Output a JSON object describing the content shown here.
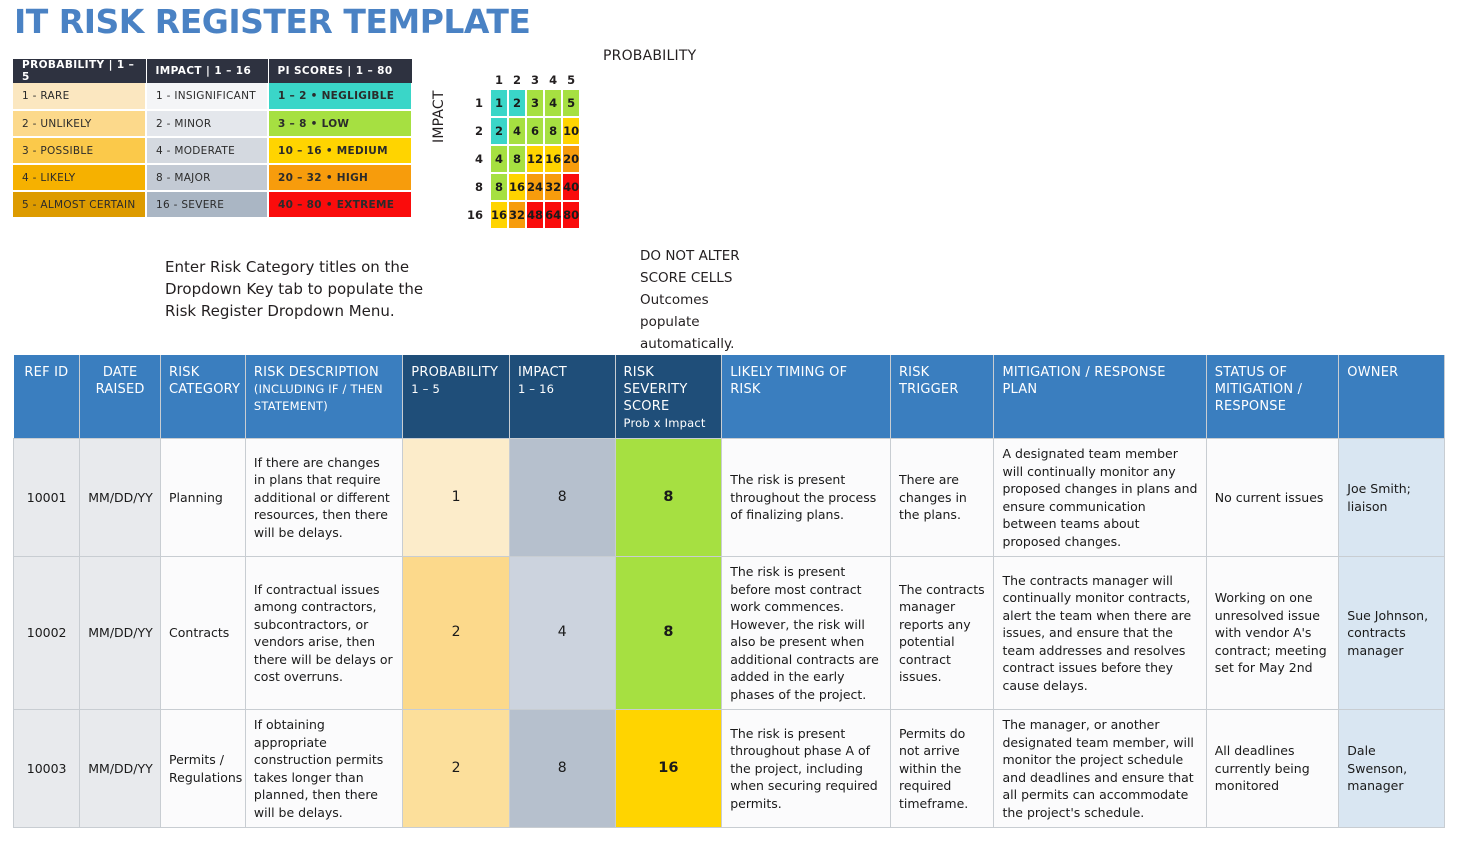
{
  "title": "IT RISK REGISTER TEMPLATE",
  "legend": {
    "headers": [
      "PROBABILITY | 1 – 5",
      "IMPACT | 1 – 16",
      "PI SCORES | 1 – 80"
    ],
    "probability": [
      {
        "label": "1 - RARE",
        "color": "#fbe7c0"
      },
      {
        "label": "2 - UNLIKELY",
        "color": "#fcd98b"
      },
      {
        "label": "3 - POSSIBLE",
        "color": "#fbc council"
      },
      {
        "label": "4 - LIKELY",
        "color": "#f6b100"
      },
      {
        "label": "5 - ALMOST CERTAIN",
        "color": "#dd9b00"
      }
    ],
    "impact": [
      {
        "label": "1 - INSIGNIFICANT",
        "color": "#f4f5f7"
      },
      {
        "label": "2 - MINOR",
        "color": "#e4e7ec"
      },
      {
        "label": "4 - MODERATE",
        "color": "#d4d9e0"
      },
      {
        "label": "8 - MAJOR",
        "color": "#c3cad4"
      },
      {
        "label": "16 - SEVERE",
        "color": "#aab6c4"
      }
    ],
    "pi_scores": [
      {
        "label": "1 – 2 • NEGLIGIBLE",
        "color": "#3ad6c8"
      },
      {
        "label": "3 – 8 • LOW",
        "color": "#a6e041"
      },
      {
        "label": "10 – 16 • MEDIUM",
        "color": "#ffd400"
      },
      {
        "label": "20 – 32 • HIGH",
        "color": "#f79c0c"
      },
      {
        "label": "40 – 80 • EXTREME",
        "color": "#fa0c0c"
      }
    ]
  },
  "chart_data": {
    "type": "heatmap",
    "title": "PROBABILITY",
    "xlabel": "PROBABILITY",
    "ylabel": "IMPACT",
    "x_ticks": [
      "1",
      "2",
      "3",
      "4",
      "5"
    ],
    "y_ticks": [
      "1",
      "2",
      "4",
      "8",
      "16"
    ],
    "grid": false,
    "legend_position": "none",
    "rows": [
      {
        "impact": "1",
        "values": [
          "1",
          "2",
          "3",
          "4",
          "5"
        ],
        "colors": [
          "#3ad6c8",
          "#3ad6c8",
          "#a6e041",
          "#a6e041",
          "#a6e041"
        ]
      },
      {
        "impact": "2",
        "values": [
          "2",
          "4",
          "6",
          "8",
          "10"
        ],
        "colors": [
          "#3ad6c8",
          "#a6e041",
          "#a6e041",
          "#a6e041",
          "#ffd400"
        ]
      },
      {
        "impact": "4",
        "values": [
          "4",
          "8",
          "12",
          "16",
          "20"
        ],
        "colors": [
          "#a6e041",
          "#a6e041",
          "#ffd400",
          "#ffd400",
          "#f79c0c"
        ]
      },
      {
        "impact": "8",
        "values": [
          "8",
          "16",
          "24",
          "32",
          "40"
        ],
        "colors": [
          "#a6e041",
          "#ffd400",
          "#f79c0c",
          "#f79c0c",
          "#fa0c0c"
        ]
      },
      {
        "impact": "16",
        "values": [
          "16",
          "32",
          "48",
          "64",
          "80"
        ],
        "colors": [
          "#ffd400",
          "#f79c0c",
          "#fa0c0c",
          "#fa0c0c",
          "#fa0c0c"
        ]
      }
    ]
  },
  "notes": {
    "left": "Enter Risk Category titles on the Dropdown Key tab to populate the Risk Register Dropdown Menu.",
    "right": "DO NOT ALTER SCORE CELLS Outcomes populate automatically."
  },
  "register": {
    "headers": [
      {
        "main": "REF ID",
        "sub": ""
      },
      {
        "main": "DATE RAISED",
        "sub": ""
      },
      {
        "main": "RISK CATEGORY",
        "sub": ""
      },
      {
        "main": "RISK DESCRIPTION",
        "sub": "(INCLUDING IF / THEN STATEMENT)"
      },
      {
        "main": "PROBABILITY",
        "sub": "1 – 5"
      },
      {
        "main": "IMPACT",
        "sub": "1 – 16"
      },
      {
        "main": "RISK SEVERITY SCORE",
        "sub": "Prob x Impact"
      },
      {
        "main": "LIKELY TIMING OF RISK",
        "sub": ""
      },
      {
        "main": "RISK TRIGGER",
        "sub": ""
      },
      {
        "main": "MITIGATION / RESPONSE PLAN",
        "sub": ""
      },
      {
        "main": "STATUS OF MITIGATION / RESPONSE",
        "sub": ""
      },
      {
        "main": "OWNER",
        "sub": ""
      }
    ],
    "rows": [
      {
        "ref_id": "10001",
        "date_raised": "MM/DD/YY",
        "risk_category": "Planning",
        "risk_description": "If there are changes in plans that require additional or different resources, then there will be delays.",
        "probability": "1",
        "probability_color": "#fcecca",
        "impact": "8",
        "impact_color": "#b6c0cd",
        "severity": "8",
        "severity_color": "#a6e041",
        "likely_timing": "The risk is present throughout the process of finalizing plans.",
        "risk_trigger": "There are changes in the plans.",
        "mitigation_plan": "A designated team member will continually monitor any proposed changes in plans and ensure communication between teams about proposed changes.",
        "status": "No current issues",
        "owner": "Joe Smith; liaison"
      },
      {
        "ref_id": "10002",
        "date_raised": "MM/DD/YY",
        "risk_category": "Contracts",
        "risk_description": "If contractual issues among contractors, subcontractors, or vendors arise, then there will be delays or cost overruns.",
        "probability": "2",
        "probability_color": "#fcd98b",
        "impact": "4",
        "impact_color": "#ccd3de",
        "severity": "8",
        "severity_color": "#a6e041",
        "likely_timing": "The risk is present before most contract work commences. However, the risk will also be present when additional contracts are added in the early phases of the project.",
        "risk_trigger": "The contracts manager reports any potential contract issues.",
        "mitigation_plan": "The contracts manager will continually monitor contracts, alert the team when there are issues, and ensure that the team addresses and resolves contract issues before they cause delays.",
        "status": "Working on one unresolved issue with vendor A's contract; meeting set for May 2nd",
        "owner": "Sue Johnson, contracts manager"
      },
      {
        "ref_id": "10003",
        "date_raised": "MM/DD/YY",
        "risk_category": "Permits / Regulations",
        "risk_description": "If obtaining appropriate construction permits takes longer than planned, then there will be delays.",
        "probability": "2",
        "probability_color": "#fcdf9b",
        "impact": "8",
        "impact_color": "#b6c0cd",
        "severity": "16",
        "severity_color": "#ffd400",
        "likely_timing": "The risk is present throughout phase A of the project, including when securing required permits.",
        "risk_trigger": "Permits do not arrive within the required timeframe.",
        "mitigation_plan": "The manager, or another designated team member, will monitor the project schedule and deadlines and ensure that all permits can accommodate the project's schedule.",
        "status": "All deadlines currently being monitored",
        "owner": "Dale Swenson, manager"
      }
    ]
  }
}
